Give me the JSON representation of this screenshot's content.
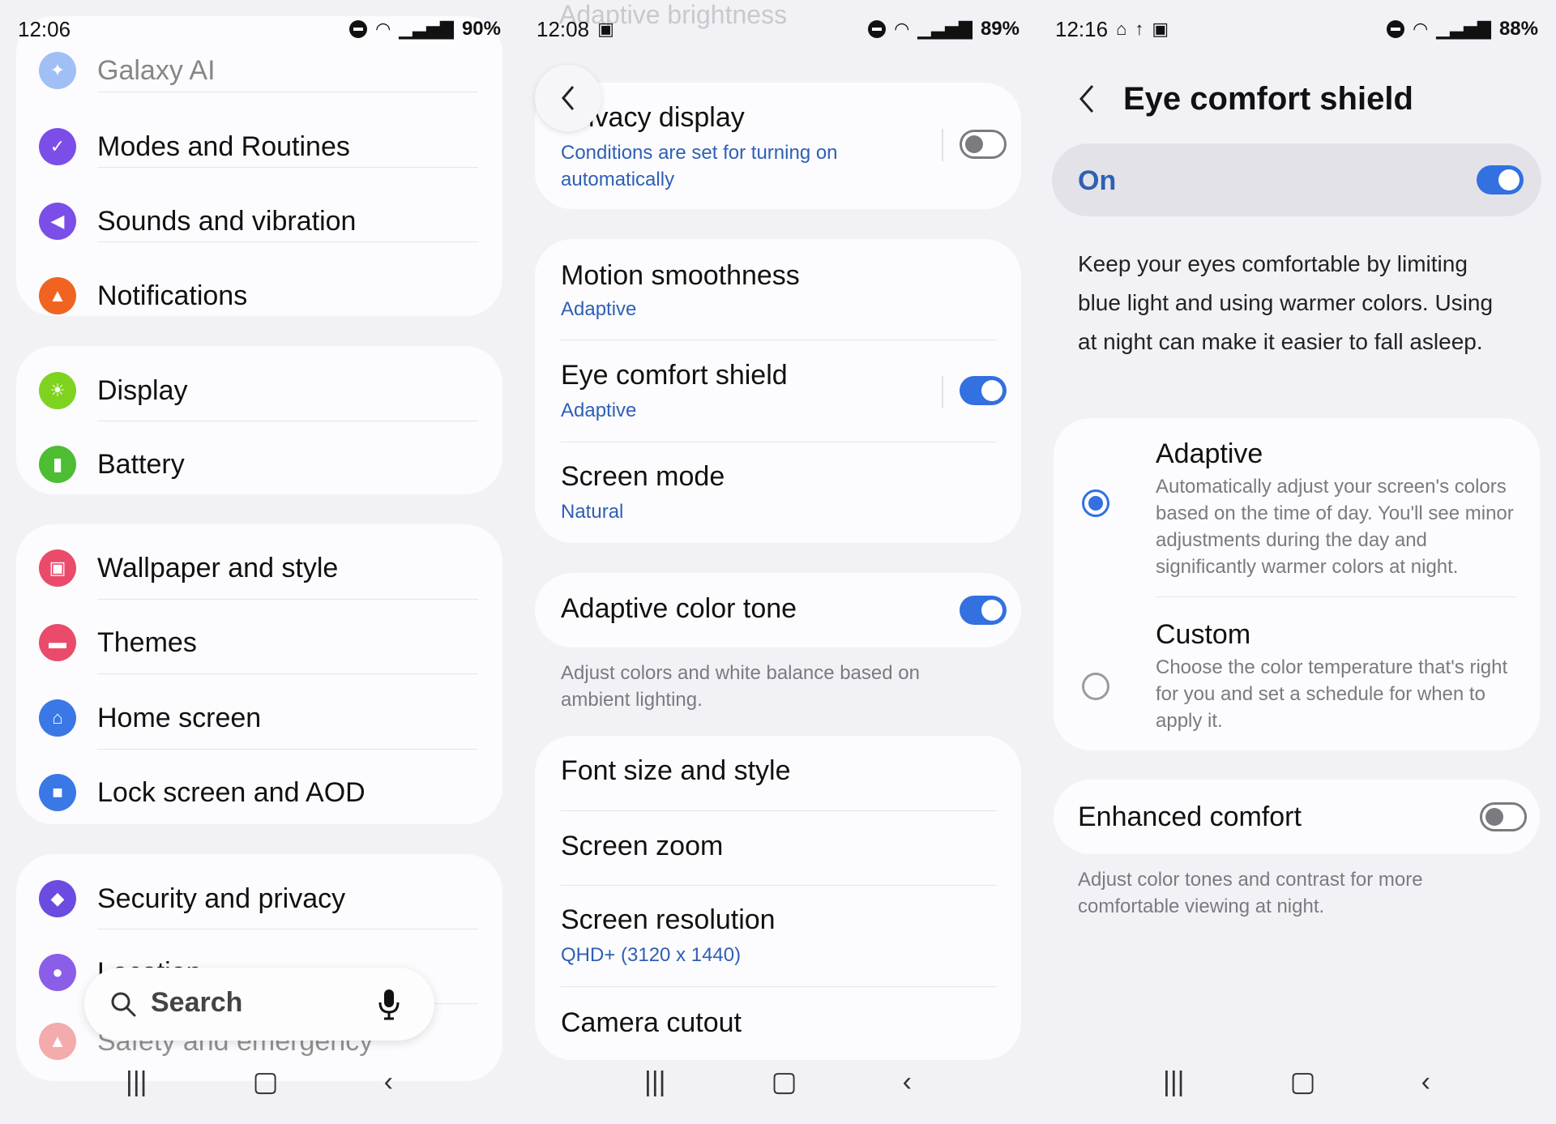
{
  "panel1": {
    "status": {
      "time": "12:06",
      "battery": "90%"
    },
    "items": [
      {
        "label": "Galaxy AI",
        "color": "#7aa6f0",
        "icon": "sparkle-icon"
      },
      {
        "label": "Modes and Routines",
        "color": "#7b4ee8",
        "icon": "check-circle-icon"
      },
      {
        "label": "Sounds and vibration",
        "color": "#7b4ee8",
        "icon": "speaker-icon"
      },
      {
        "label": "Notifications",
        "color": "#f06320",
        "icon": "bell-icon"
      },
      {
        "label": "Display",
        "color": "#7ed321",
        "icon": "sun-icon"
      },
      {
        "label": "Battery",
        "color": "#4dbd34",
        "icon": "battery-icon"
      },
      {
        "label": "Wallpaper and style",
        "color": "#ea4b6a",
        "icon": "image-icon"
      },
      {
        "label": "Themes",
        "color": "#ea4b6a",
        "icon": "brush-icon"
      },
      {
        "label": "Home screen",
        "color": "#3a78e6",
        "icon": "home-icon"
      },
      {
        "label": "Lock screen and AOD",
        "color": "#3a78e6",
        "icon": "lock-icon"
      },
      {
        "label": "Security and privacy",
        "color": "#6b4be0",
        "icon": "shield-icon"
      },
      {
        "label": "Location",
        "color": "#8a5ee8",
        "icon": "location-icon"
      },
      {
        "label": "Safety and emergency",
        "color": "#ea4b4b",
        "icon": "siren-icon"
      }
    ],
    "search": {
      "placeholder": "Search"
    }
  },
  "panel2": {
    "status": {
      "time": "12:08",
      "battery": "89%"
    },
    "faded_header": "Adaptive brightness",
    "privacy": {
      "title": "Privacy display",
      "sub": "Conditions are set for turning on automatically"
    },
    "motion": {
      "title": "Motion smoothness",
      "value": "Adaptive"
    },
    "eye": {
      "title": "Eye comfort shield",
      "value": "Adaptive"
    },
    "screen_mode": {
      "title": "Screen mode",
      "value": "Natural"
    },
    "adaptive_tone": {
      "title": "Adaptive color tone",
      "helper": "Adjust colors and white balance based on ambient lighting."
    },
    "font": "Font size and style",
    "zoom": "Screen zoom",
    "resolution": {
      "title": "Screen resolution",
      "value": "QHD+ (3120 x 1440)"
    },
    "cutout": "Camera cutout"
  },
  "panel3": {
    "status": {
      "time": "12:16",
      "battery": "88%"
    },
    "title": "Eye comfort shield",
    "on_label": "On",
    "description": "Keep your eyes comfortable by limiting blue light and using warmer colors. Using at night can make it easier to fall asleep.",
    "adaptive": {
      "title": "Adaptive",
      "desc": "Automatically adjust your screen's colors based on the time of day. You'll see minor adjustments during the day and significantly warmer colors at night."
    },
    "custom": {
      "title": "Custom",
      "desc": "Choose the color temperature that's right for you and set a schedule for when to apply it."
    },
    "enhanced": {
      "title": "Enhanced comfort",
      "helper": "Adjust color tones and contrast for more comfortable viewing at night."
    }
  },
  "colors": {
    "accent": "#3370e0",
    "link": "#2f5fb5"
  }
}
